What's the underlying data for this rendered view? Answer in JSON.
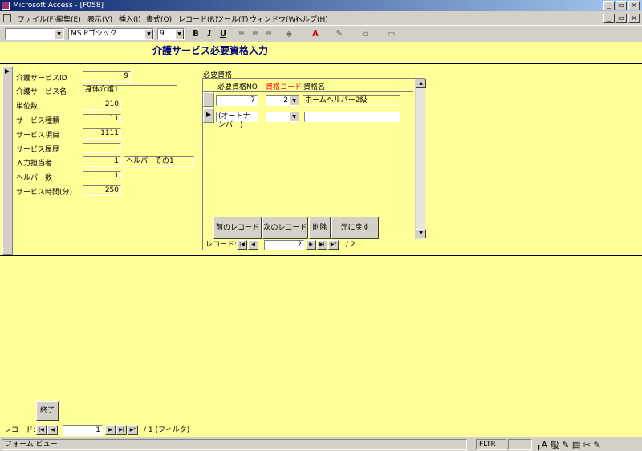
{
  "window": {
    "title": "Microsoft Access - [F058]",
    "min": "_",
    "restore": "▭",
    "close": "×"
  },
  "menu": [
    "ファイル(F)",
    "編集(E)",
    "表示(V)",
    "挿入(I)",
    "書式(O)",
    "レコード(R)",
    "ツール(T)",
    "ウィンドウ(W)",
    "ヘルプ(H)"
  ],
  "toolbar": {
    "font": "MS Pゴシック",
    "size": "9",
    "bold": "B",
    "italic": "I",
    "underline": "U"
  },
  "form": {
    "title": "介護サービス必要資格入力",
    "labels": [
      "介護サービスID",
      "介護サービス名",
      "単位数",
      "サービス種類",
      "サービス項目",
      "サービス履歴",
      "入力担当者",
      "ヘルパー数",
      "サービス時間(分)"
    ],
    "values": {
      "id": "9",
      "name": "身体介護1",
      "units": "210",
      "type": "11",
      "item": "1111",
      "history": "",
      "staff": "1",
      "staff_name": "ヘルパーその1",
      "helpers": "1",
      "minutes": "250"
    },
    "exit": "終了"
  },
  "subform": {
    "caption": "必要資格",
    "headers": [
      "必要資格NO",
      "資格コード",
      "資格名"
    ],
    "rows": [
      {
        "no": "7",
        "code": "2",
        "name": "ホームヘルパー2級"
      },
      {
        "no": "(オートナンバー)",
        "code": "",
        "name": ""
      }
    ],
    "buttons": [
      "前のレコード",
      "次のレコード",
      "削除",
      "元に戻す"
    ],
    "nav": {
      "label": "レコード:",
      "current": "2",
      "total": "/ 2"
    }
  },
  "mainnav": {
    "label": "レコード:",
    "current": "1",
    "total": "/ 1 (フィルタ)"
  },
  "status": {
    "view": "フォーム ビュー",
    "fltr": "FLTR"
  },
  "colors": {
    "form_bg": "#ffff99",
    "title": "#00007f",
    "code_header": "#ff0000"
  }
}
